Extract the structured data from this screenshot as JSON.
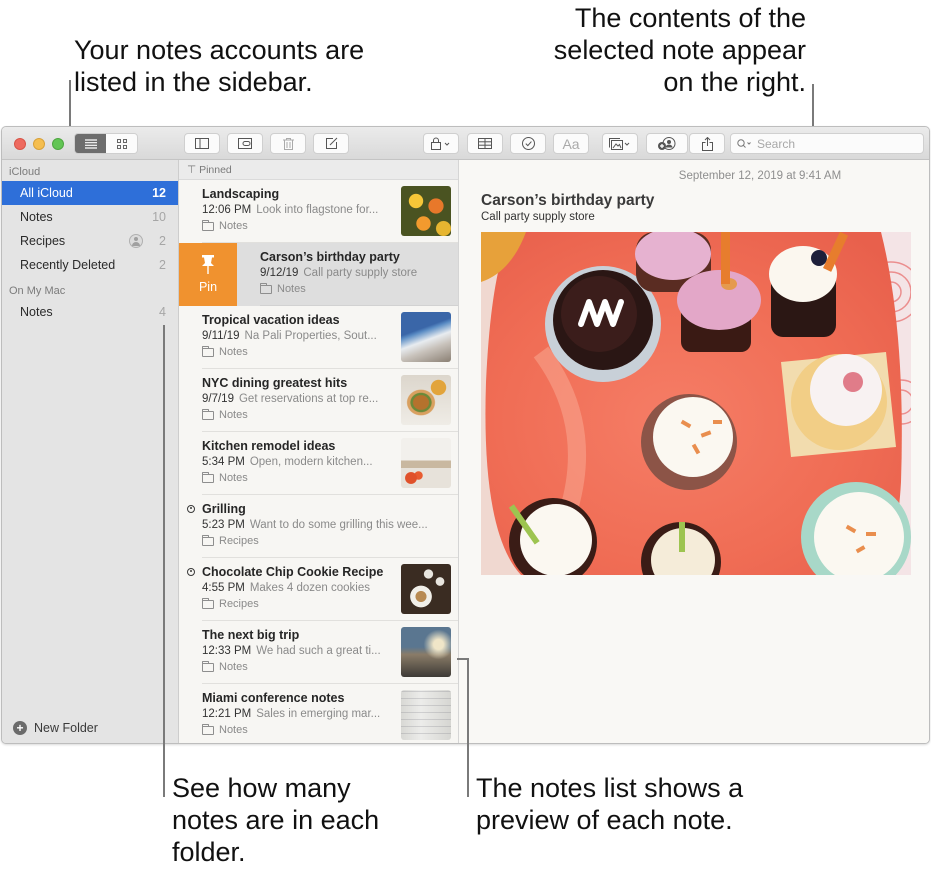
{
  "callouts": {
    "top_left": "Your notes accounts are listed in the sidebar.",
    "top_right": "The contents of the selected note appear on the right.",
    "bottom_left": "See how many notes are in each folder.",
    "bottom_right": "The notes list shows a preview of each note."
  },
  "toolbar": {
    "view_list_icon": "list-view-icon",
    "view_gallery_icon": "gallery-view-icon",
    "buttons": [
      {
        "name": "toggle-sidebar",
        "icon": "sidebar-icon"
      },
      {
        "name": "attachments-browser",
        "icon": "attachments-icon"
      },
      {
        "name": "delete",
        "icon": "trash-icon"
      },
      {
        "name": "new-note",
        "icon": "compose-icon"
      },
      {
        "name": "lock",
        "icon": "lock-icon"
      },
      {
        "name": "table",
        "icon": "table-icon"
      },
      {
        "name": "checklist",
        "icon": "checklist-icon"
      },
      {
        "name": "format",
        "icon": "format-icon",
        "label": "Aa"
      },
      {
        "name": "media",
        "icon": "photo-icon"
      },
      {
        "name": "add-people",
        "icon": "add-people-icon"
      },
      {
        "name": "share",
        "icon": "share-icon"
      }
    ],
    "search_placeholder": "Search"
  },
  "sidebar": {
    "sections": [
      {
        "title": "iCloud",
        "items": [
          {
            "label": "All iCloud",
            "count": "12",
            "selected": true
          },
          {
            "label": "Notes",
            "count": "10"
          },
          {
            "label": "Recipes",
            "count": "2",
            "shared": true
          },
          {
            "label": "Recently Deleted",
            "count": "2"
          }
        ]
      },
      {
        "title": "On My Mac",
        "items": [
          {
            "label": "Notes",
            "count": "4"
          }
        ]
      }
    ],
    "new_folder_label": "New Folder"
  },
  "notes_list": {
    "pinned_label": "Pinned",
    "pin_action_label": "Pin",
    "notes": [
      {
        "title": "Landscaping",
        "date": "12:06 PM",
        "snippet": "Look into flagstone for...",
        "folder": "Notes",
        "thumbnail": "flowers"
      },
      {
        "title": "Carson’s birthday party",
        "date": "9/12/19",
        "snippet": "Call party supply store",
        "folder": "Notes",
        "swiped": true
      },
      {
        "title": "Tropical vacation ideas",
        "date": "9/11/19",
        "snippet": "Na Pali Properties, Sout...",
        "folder": "Notes",
        "thumbnail": "coast"
      },
      {
        "title": "NYC dining greatest hits",
        "date": "9/7/19",
        "snippet": "Get reservations at top re...",
        "folder": "Notes",
        "thumbnail": "burger"
      },
      {
        "title": "Kitchen remodel ideas",
        "date": "5:34 PM",
        "snippet": "Open, modern kitchen...",
        "folder": "Notes",
        "thumbnail": "kitchen"
      },
      {
        "title": "Grilling",
        "date": "5:23 PM",
        "snippet": "Want to do some grilling this wee...",
        "folder": "Recipes",
        "shared": true
      },
      {
        "title": "Chocolate Chip Cookie Recipe",
        "date": "4:55 PM",
        "snippet": "Makes 4 dozen cookies",
        "folder": "Recipes",
        "shared": true,
        "thumbnail": "cookies"
      },
      {
        "title": "The next big trip",
        "date": "12:33 PM",
        "snippet": "We had such a great ti...",
        "folder": "Notes",
        "thumbnail": "bike"
      },
      {
        "title": "Miami conference notes",
        "date": "12:21 PM",
        "snippet": "Sales in emerging mar...",
        "folder": "Notes",
        "thumbnail": "sketch"
      }
    ]
  },
  "editor": {
    "timestamp": "September 12, 2019 at 9:41 AM",
    "title": "Carson’s birthday party",
    "body": "Call party supply store",
    "image": "cupcakes-photo"
  },
  "colors": {
    "selection": "#2e6fd9",
    "pin_action": "#f0922f"
  }
}
